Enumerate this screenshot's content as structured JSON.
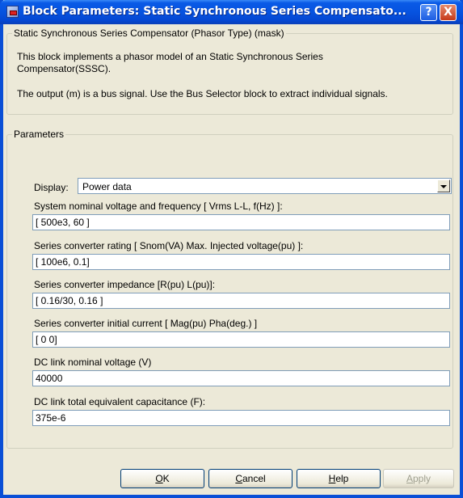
{
  "window": {
    "title": "Block Parameters: Static Synchronous Series Compensato...",
    "help_label": "?",
    "close_label": "X"
  },
  "mask": {
    "legend": "Static Synchronous Series Compensator (Phasor Type) (mask)",
    "desc_line1": "This block implements a phasor model of an Static Synchronous Series",
    "desc_line2": "Compensator(SSSC).",
    "desc_line3": "The output (m) is a bus signal. Use the Bus Selector block to extract individual signals."
  },
  "parameters": {
    "legend": "Parameters",
    "display_label": "Display:",
    "display_value": "Power data",
    "fields": [
      {
        "label": "System nominal voltage and frequency [ Vrms L-L, f(Hz) ]:",
        "value": "[ 500e3, 60 ]"
      },
      {
        "label": "Series converter rating [ Snom(VA)   Max. Injected voltage(pu) ]:",
        "value": "[ 100e6, 0.1]"
      },
      {
        "label": "Series  converter impedance [R(pu)  L(pu)]:",
        "value": "[ 0.16/30, 0.16 ]"
      },
      {
        "label": "Series converter initial current [ Mag(pu)  Pha(deg.) ]",
        "value": "[ 0 0]"
      },
      {
        "label": "DC link nominal voltage (V)",
        "value": "40000"
      },
      {
        "label": "DC link total equivalent capacitance (F):",
        "value": "375e-6"
      }
    ]
  },
  "buttons": {
    "ok": {
      "mnemonic": "O",
      "rest": "K"
    },
    "cancel": {
      "mnemonic": "C",
      "rest": "ancel"
    },
    "help": {
      "mnemonic": "H",
      "rest": "elp"
    },
    "apply": {
      "mnemonic": "A",
      "rest": "pply"
    }
  }
}
